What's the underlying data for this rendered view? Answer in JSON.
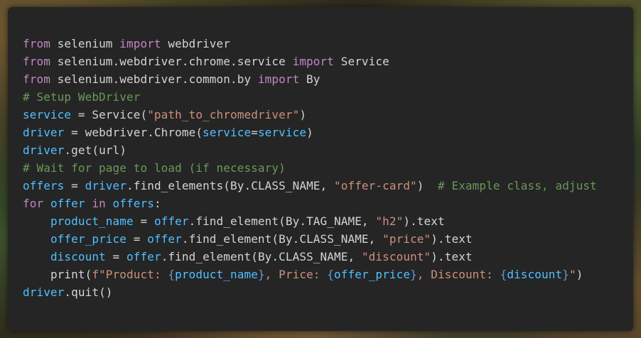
{
  "colors": {
    "panel_background": "#252526",
    "keyword": "#c586c0",
    "variable": "#4fc1ff",
    "string": "#ce9178",
    "comment": "#6a9955",
    "plain": "#d4d4d4",
    "brace": "#569cd6"
  },
  "code": {
    "language": "python",
    "lines": [
      [
        {
          "t": "kw",
          "v": "from"
        },
        {
          "t": "plain",
          "v": " selenium "
        },
        {
          "t": "kw",
          "v": "import"
        },
        {
          "t": "plain",
          "v": " webdriver"
        }
      ],
      [
        {
          "t": "kw",
          "v": "from"
        },
        {
          "t": "plain",
          "v": " selenium.webdriver.chrome.service "
        },
        {
          "t": "kw",
          "v": "import"
        },
        {
          "t": "plain",
          "v": " Service"
        }
      ],
      [
        {
          "t": "kw",
          "v": "from"
        },
        {
          "t": "plain",
          "v": " selenium.webdriver.common.by "
        },
        {
          "t": "kw",
          "v": "import"
        },
        {
          "t": "plain",
          "v": " By"
        }
      ],
      [
        {
          "t": "cmt",
          "v": "# Setup WebDriver"
        }
      ],
      [
        {
          "t": "var",
          "v": "service"
        },
        {
          "t": "plain",
          "v": " = Service("
        },
        {
          "t": "str",
          "v": "\"path_to_chromedriver\""
        },
        {
          "t": "plain",
          "v": ")"
        }
      ],
      [
        {
          "t": "var",
          "v": "driver"
        },
        {
          "t": "plain",
          "v": " = webdriver.Chrome("
        },
        {
          "t": "var",
          "v": "service"
        },
        {
          "t": "plain",
          "v": "="
        },
        {
          "t": "var",
          "v": "service"
        },
        {
          "t": "plain",
          "v": ")"
        }
      ],
      [
        {
          "t": "var",
          "v": "driver"
        },
        {
          "t": "plain",
          "v": ".get(url)"
        }
      ],
      [
        {
          "t": "cmt",
          "v": "# Wait for page to load (if necessary)"
        }
      ],
      [
        {
          "t": "var",
          "v": "offers"
        },
        {
          "t": "plain",
          "v": " = "
        },
        {
          "t": "var",
          "v": "driver"
        },
        {
          "t": "plain",
          "v": ".find_elements(By.CLASS_NAME, "
        },
        {
          "t": "str",
          "v": "\"offer-card\""
        },
        {
          "t": "plain",
          "v": ")  "
        },
        {
          "t": "cmt",
          "v": "# Example class, adjust"
        }
      ],
      [
        {
          "t": "kw",
          "v": "for"
        },
        {
          "t": "plain",
          "v": " "
        },
        {
          "t": "var",
          "v": "offer"
        },
        {
          "t": "plain",
          "v": " "
        },
        {
          "t": "kw",
          "v": "in"
        },
        {
          "t": "plain",
          "v": " "
        },
        {
          "t": "var",
          "v": "offers"
        },
        {
          "t": "plain",
          "v": ":"
        }
      ],
      [
        {
          "t": "plain",
          "v": "    "
        },
        {
          "t": "var",
          "v": "product_name"
        },
        {
          "t": "plain",
          "v": " = "
        },
        {
          "t": "var",
          "v": "offer"
        },
        {
          "t": "plain",
          "v": ".find_element(By.TAG_NAME, "
        },
        {
          "t": "str",
          "v": "\"h2\""
        },
        {
          "t": "plain",
          "v": ").text"
        }
      ],
      [
        {
          "t": "plain",
          "v": "    "
        },
        {
          "t": "var",
          "v": "offer_price"
        },
        {
          "t": "plain",
          "v": " = "
        },
        {
          "t": "var",
          "v": "offer"
        },
        {
          "t": "plain",
          "v": ".find_element(By.CLASS_NAME, "
        },
        {
          "t": "str",
          "v": "\"price\""
        },
        {
          "t": "plain",
          "v": ").text"
        }
      ],
      [
        {
          "t": "plain",
          "v": "    "
        },
        {
          "t": "var",
          "v": "discount"
        },
        {
          "t": "plain",
          "v": " = "
        },
        {
          "t": "var",
          "v": "offer"
        },
        {
          "t": "plain",
          "v": ".find_element(By.CLASS_NAME, "
        },
        {
          "t": "str",
          "v": "\"discount\""
        },
        {
          "t": "plain",
          "v": ").text"
        }
      ],
      [
        {
          "t": "plain",
          "v": "    "
        },
        {
          "t": "kw2",
          "v": "print"
        },
        {
          "t": "plain",
          "v": "("
        },
        {
          "t": "str",
          "v": "f\"Product: "
        },
        {
          "t": "brace",
          "v": "{"
        },
        {
          "t": "var",
          "v": "product_name"
        },
        {
          "t": "brace",
          "v": "}"
        },
        {
          "t": "str",
          "v": ", Price: "
        },
        {
          "t": "brace",
          "v": "{"
        },
        {
          "t": "var",
          "v": "offer_price"
        },
        {
          "t": "brace",
          "v": "}"
        },
        {
          "t": "str",
          "v": ", Discount: "
        },
        {
          "t": "brace",
          "v": "{"
        },
        {
          "t": "var",
          "v": "discount"
        },
        {
          "t": "brace",
          "v": "}"
        },
        {
          "t": "str",
          "v": "\""
        },
        {
          "t": "plain",
          "v": ")"
        }
      ],
      [
        {
          "t": "var",
          "v": "driver"
        },
        {
          "t": "plain",
          "v": ".quit()"
        }
      ]
    ]
  }
}
